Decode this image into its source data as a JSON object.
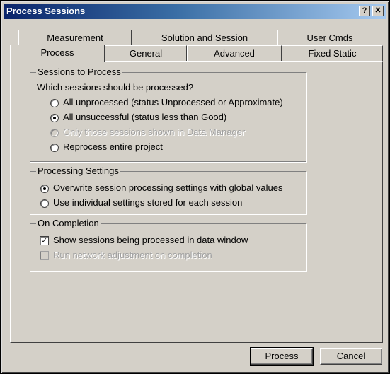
{
  "window": {
    "title": "Process Sessions",
    "help_button": "?",
    "close_button": "✕"
  },
  "tabs_back": [
    "Measurement",
    "Solution and Session",
    "User Cmds"
  ],
  "tabs_front": [
    "Process",
    "General",
    "Advanced",
    "Fixed Static"
  ],
  "active_tab": "Process",
  "sessions_group": {
    "legend": "Sessions to Process",
    "question": "Which sessions should be processed?",
    "options": [
      {
        "label": "All unprocessed (status Unprocessed or Approximate)",
        "checked": false,
        "disabled": false
      },
      {
        "label": "All unsuccessful (status less than Good)",
        "checked": true,
        "disabled": false
      },
      {
        "label": "Only those sessions shown in Data Manager",
        "checked": false,
        "disabled": true
      },
      {
        "label": "Reprocess entire project",
        "checked": false,
        "disabled": false
      }
    ]
  },
  "settings_group": {
    "legend": "Processing Settings",
    "options": [
      {
        "label": "Overwrite session processing settings with global values",
        "checked": true
      },
      {
        "label": "Use individual settings stored for each session",
        "checked": false
      }
    ]
  },
  "completion_group": {
    "legend": "On Completion",
    "options": [
      {
        "label": "Show sessions being processed in data window",
        "checked": true,
        "disabled": false
      },
      {
        "label": "Run network adjustment on completion",
        "checked": false,
        "disabled": true
      }
    ]
  },
  "buttons": {
    "process": "Process",
    "cancel": "Cancel"
  }
}
